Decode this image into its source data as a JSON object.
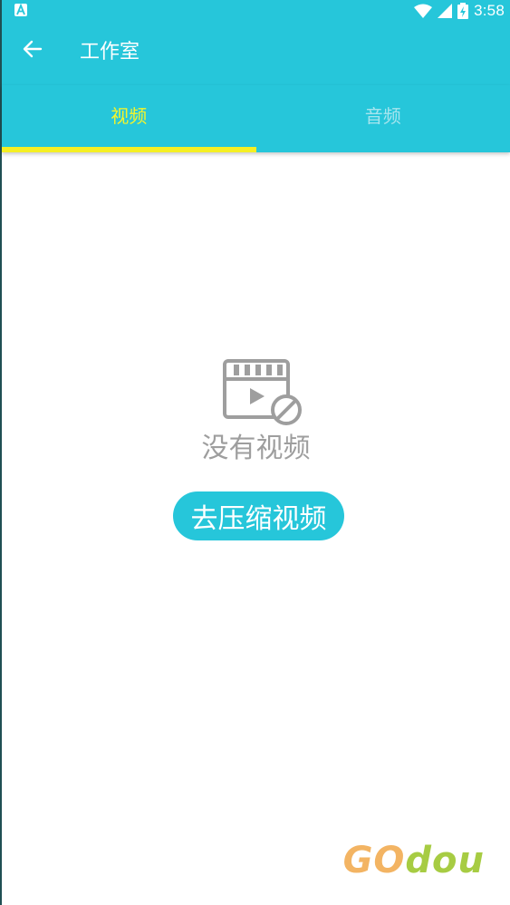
{
  "status_bar": {
    "time": "3:58",
    "app_icon": "a-icon",
    "icons": [
      "wifi-icon",
      "signal-icon",
      "battery-icon"
    ],
    "background": "#26c6da"
  },
  "toolbar": {
    "back_icon": "arrow-left-icon",
    "title": "工作室",
    "background": "#26c6da"
  },
  "tabs": [
    {
      "label": "视频",
      "active": true,
      "color": "#f5f52a"
    },
    {
      "label": "音频",
      "active": false,
      "color": "#a7e5ee"
    }
  ],
  "tab_indicator_color": "#f5ef23",
  "empty_state": {
    "icon": "video-off-icon",
    "message": "没有视频",
    "button_label": "去压缩视频",
    "button_color": "#26c6da"
  },
  "watermark": {
    "part1": "GO",
    "part2": "dou"
  }
}
